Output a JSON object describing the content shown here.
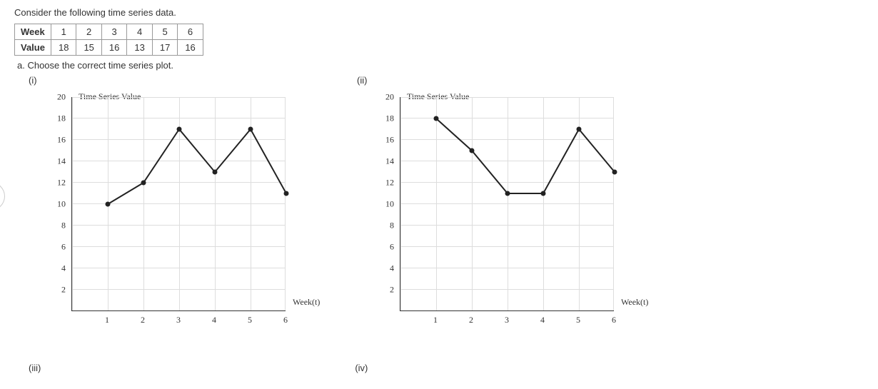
{
  "intro": "Consider the following time series data.",
  "table": {
    "row1_label": "Week",
    "row2_label": "Value",
    "weeks": [
      "1",
      "2",
      "3",
      "4",
      "5",
      "6"
    ],
    "values": [
      "18",
      "15",
      "16",
      "13",
      "17",
      "16"
    ]
  },
  "subq": "a. Choose the correct time series plot.",
  "labels": {
    "i": "(i)",
    "ii": "(ii)",
    "iii": "(iii)",
    "iv": "(iv)"
  },
  "chart_common": {
    "title": "Time Series Value",
    "xlabel": "Week(t)",
    "y_ticks": [
      "2",
      "4",
      "6",
      "8",
      "10",
      "12",
      "14",
      "16",
      "18",
      "20"
    ],
    "x_ticks": [
      "1",
      "2",
      "3",
      "4",
      "5",
      "6"
    ],
    "ylim": [
      0,
      20
    ],
    "xlim": [
      0,
      6
    ]
  },
  "chart_data": [
    {
      "id": "i",
      "type": "line",
      "title": "Time Series Value",
      "xlabel": "Week(t)",
      "ylabel": "",
      "xlim": [
        0,
        6
      ],
      "ylim": [
        0,
        20
      ],
      "x": [
        1,
        2,
        3,
        4,
        5,
        6
      ],
      "y": [
        10,
        12,
        17,
        13,
        17,
        11
      ]
    },
    {
      "id": "ii",
      "type": "line",
      "title": "Time Series Value",
      "xlabel": "Week(t)",
      "ylabel": "",
      "xlim": [
        0,
        6
      ],
      "ylim": [
        0,
        20
      ],
      "x": [
        1,
        2,
        3,
        4,
        5,
        6
      ],
      "y": [
        18,
        15,
        11,
        11,
        17,
        13
      ]
    }
  ]
}
